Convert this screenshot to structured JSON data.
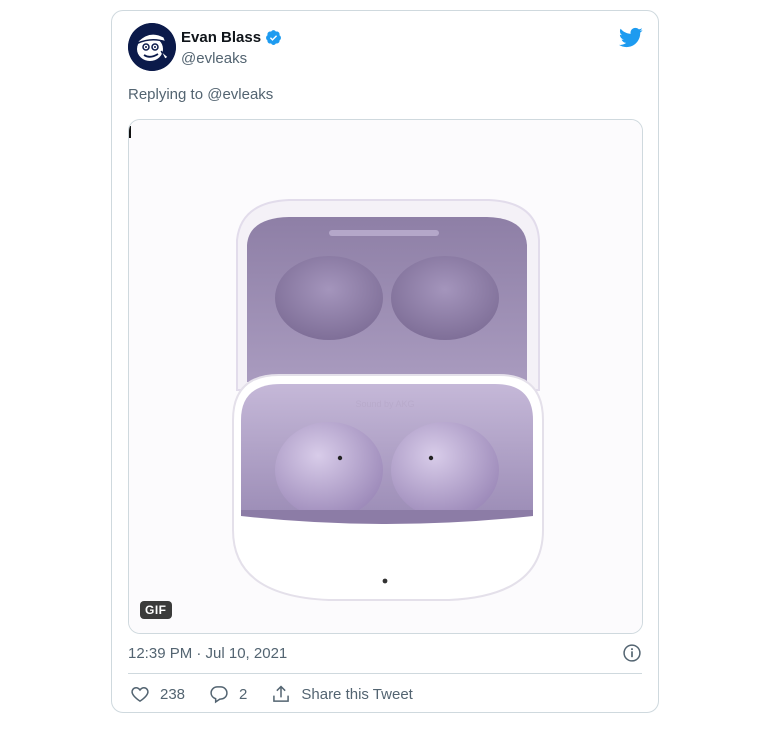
{
  "author": {
    "name": "Evan Blass",
    "handle": "@evleaks",
    "verified": true,
    "avatar_icon": "cartoon-avatar-icon"
  },
  "reply_prefix": "Replying to",
  "reply_mention": "@evleaks",
  "media": {
    "type": "GIF",
    "badge": "GIF",
    "case_label": "Sound by AKG"
  },
  "timestamp": "12:39 PM · Jul 10, 2021",
  "actions": {
    "likes": "238",
    "replies": "2",
    "share_label": "Share this Tweet"
  },
  "colors": {
    "brand_blue": "#1d9bf0",
    "text_secondary": "#536471",
    "border": "#cfd9de",
    "lavender": "#a896c0"
  }
}
